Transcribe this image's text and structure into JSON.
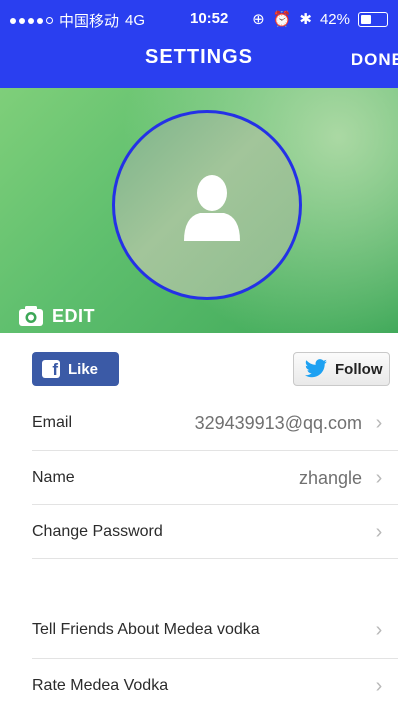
{
  "status_bar": {
    "carrier": "中国移动",
    "network": "4G",
    "time": "10:52",
    "battery": "42%"
  },
  "nav": {
    "title": "SETTINGS",
    "done": "DONE"
  },
  "profile": {
    "edit_label": "EDIT"
  },
  "social": {
    "like_label": "Like",
    "follow_label": "Follow"
  },
  "settings": {
    "email_label": "Email",
    "email_value": "329439913@qq.com",
    "name_label": "Name",
    "name_value": "zhangle",
    "password_label": "Change Password",
    "tell_friends_label": "Tell Friends About Medea vodka",
    "rate_label": "Rate Medea Vodka"
  },
  "colors": {
    "header_blue": "#2a3ff0",
    "facebook_blue": "#3b5aa6",
    "twitter_blue": "#1da1f2"
  }
}
